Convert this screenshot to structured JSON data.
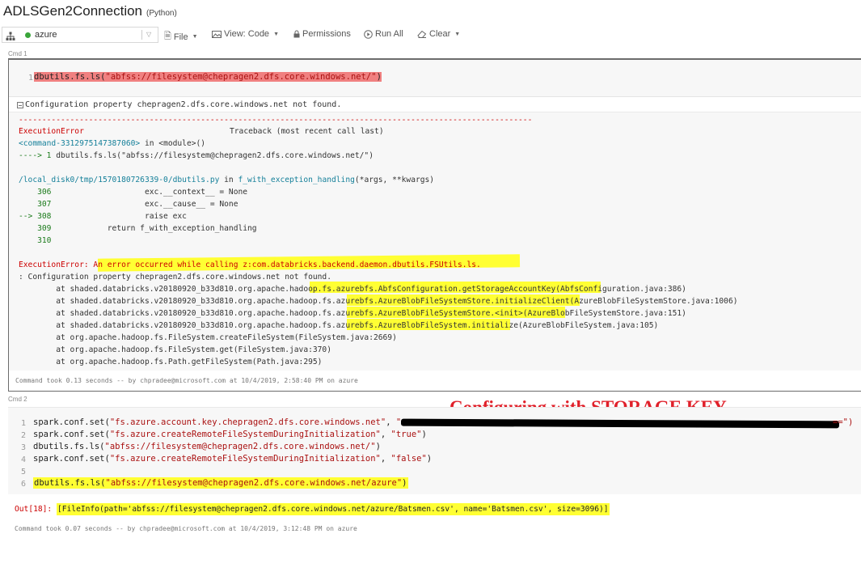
{
  "notebook": {
    "title": "ADLSGen2Connection",
    "language": "(Python)"
  },
  "toolbar": {
    "cluster_name": "azure",
    "cluster_status_color": "#3aa53a",
    "cluster_icon": "sitemap-icon",
    "file": "File",
    "view": "View: Code",
    "permissions": "Permissions",
    "run_all": "Run All",
    "clear": "Clear"
  },
  "cmd1": {
    "label": "Cmd 1",
    "line_number": "1",
    "code": "dbutils.fs.ls(\"abfss://filesystem@chepragen2.dfs.core.windows.net/\")",
    "code_fn": "dbutils.fs.ls(",
    "code_str": "\"abfss://filesystem@chepragen2.dfs.core.windows.net/\"",
    "code_close": ")",
    "output_header": "Configuration property chepragen2.dfs.core.windows.net not found.",
    "traceback": {
      "divider": "--------------------------------------------------------------------------------------------------------------",
      "error_name": "ExecutionError",
      "traceback_label": "Traceback (most recent call last)",
      "command_ref": "<command-3312975147387060>",
      "in_module": " in <module>()",
      "arrow_line_prefix": "----> 1 ",
      "arrow_line_code": "dbutils.fs.ls(\"abfss://filesystem@chepragen2.dfs.core.windows.net/\")",
      "file_path": "/local_disk0/tmp/1570180726339-0/dbutils.py",
      "in_fn": " in ",
      "fn_name": "f_with_exception_handling",
      "fn_args": "(*args, **kwargs)",
      "frames": [
        {
          "marker": "    306",
          "code": "                    exc.__context__ = None"
        },
        {
          "marker": "    307",
          "code": "                    exc.__cause__ = None"
        },
        {
          "marker": "--> 308",
          "code": "                    raise exc"
        },
        {
          "marker": "    309",
          "code": "            return f_with_exception_handling"
        },
        {
          "marker": "    310",
          "code": ""
        }
      ],
      "final_error_name": "ExecutionError: ",
      "final_error_msg": "An error occurred while calling z:com.databricks.backend.daemon.dbutils.FSUtils.ls.",
      "config_line": ": Configuration property chepragen2.dfs.core.windows.net not found.",
      "stack": [
        "        at shaded.databricks.v20180920_b33d810.org.apache.hadoop.fs.azurebfs.AbfsConfiguration.getStorageAccountKey(AbfsConfiguration.java:386)",
        "        at shaded.databricks.v20180920_b33d810.org.apache.hadoop.fs.azurebfs.AzureBlobFileSystemStore.initializeClient(AzureBlobFileSystemStore.java:1006)",
        "        at shaded.databricks.v20180920_b33d810.org.apache.hadoop.fs.azurebfs.AzureBlobFileSystemStore.<init>(AzureBlobFileSystemStore.java:151)",
        "        at shaded.databricks.v20180920_b33d810.org.apache.hadoop.fs.azurebfs.AzureBlobFileSystem.initialize(AzureBlobFileSystem.java:105)",
        "        at org.apache.hadoop.fs.FileSystem.createFileSystem(FileSystem.java:2669)",
        "        at org.apache.hadoop.fs.FileSystem.get(FileSystem.java:370)",
        "        at org.apache.hadoop.fs.Path.getFileSystem(Path.java:295)"
      ]
    },
    "took": "Command took 0.13 seconds -- by chpradee@microsoft.com at 10/4/2019, 2:58:40 PM on azure"
  },
  "cmd2": {
    "label": "Cmd 2",
    "annotation": "Configuring with STORAGE KEY",
    "lines": [
      {
        "num": "1",
        "fn": "spark.conf.set(",
        "a": "\"fs.azure.account.key.chepragen2.dfs.core.windows.net\"",
        "sep": ", ",
        "b": "\"",
        "end": ""
      },
      {
        "num": "2",
        "fn": "spark.conf.set(",
        "a": "\"fs.azure.createRemoteFileSystemDuringInitialization\"",
        "sep": ", ",
        "b": "\"true\"",
        "end": ")"
      },
      {
        "num": "3",
        "fn": "dbutils.fs.ls(",
        "a": "\"abfss://filesystem@chepragen2.dfs.core.windows.net/\"",
        "sep": "",
        "b": "",
        "end": ")"
      },
      {
        "num": "4",
        "fn": "spark.conf.set(",
        "a": "\"fs.azure.createRemoteFileSystemDuringInitialization\"",
        "sep": ", ",
        "b": "\"false\"",
        "end": ")"
      },
      {
        "num": "5",
        "fn": "",
        "a": "",
        "sep": "",
        "b": "",
        "end": ""
      },
      {
        "num": "6",
        "fn": "dbutils.fs.ls(",
        "a": "\"abfss://filesystem@chepragen2.dfs.core.windows.net/azure\"",
        "sep": "",
        "b": "",
        "end": ")"
      }
    ],
    "key_tail": "==\")",
    "out_label": "Out[18]: ",
    "out_value": "[FileInfo(path='abfss://filesystem@chepragen2.dfs.core.windows.net/azure/Batsmen.csv', name='Batsmen.csv', size=3096)]",
    "took": "Command took 0.07 seconds -- by chpradee@microsoft.com at 10/4/2019, 3:12:48 PM on azure"
  },
  "colors": {
    "highlight_yellow": "#ffff33",
    "highlight_red": "#f08080",
    "annotation_red": "#e0202a",
    "error_red": "#c00000"
  }
}
